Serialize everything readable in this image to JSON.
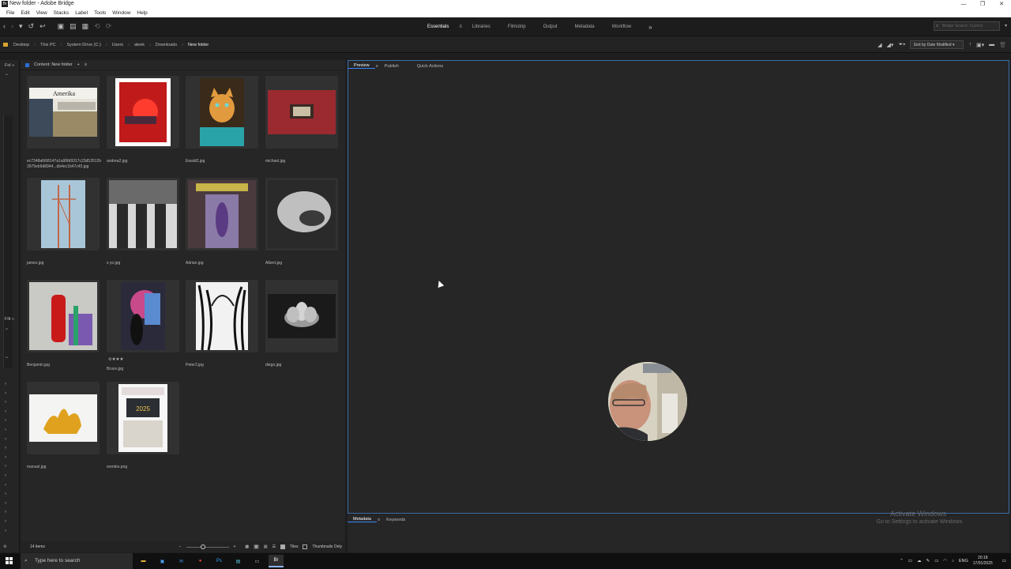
{
  "window": {
    "title": "New folder - Adobe Bridge",
    "app_icon": "Br",
    "minimize": "—",
    "restore": "❐",
    "close": "✕"
  },
  "menu": [
    "File",
    "Edit",
    "View",
    "Stacks",
    "Label",
    "Tools",
    "Window",
    "Help"
  ],
  "workspaces": {
    "items": [
      "Essentials",
      "Libraries",
      "Filmstrip",
      "Output",
      "Metadata",
      "Workflow"
    ],
    "active": "Essentials",
    "more": "»"
  },
  "search": {
    "placeholder": "Bridge Search: Current"
  },
  "breadcrumb": [
    "Desktop",
    "This PC",
    "System Drive (C:)",
    "Users",
    "aleek",
    "Downloads",
    "New folder"
  ],
  "sort": {
    "label": "Sort by Date Modified"
  },
  "left_panels": {
    "folders": "Fol",
    "filter": "Filt"
  },
  "content_panel": {
    "title": "Content: New folder",
    "add": "+"
  },
  "files": [
    {
      "name": "ec7348afb58147a1a90fd9317c23d53512b3975eb9d8944...db4ec1b47c45.jpg",
      "kind": "newspaper"
    },
    {
      "name": "andrea2.jpg",
      "kind": "red-frame"
    },
    {
      "name": "Ewald2.jpg",
      "kind": "kitten"
    },
    {
      "name": "michael.jpg",
      "kind": "red-wall"
    },
    {
      "name": "james.jpg",
      "kind": "pylon"
    },
    {
      "name": "s yo.jpg",
      "kind": "bw-stairs"
    },
    {
      "name": "Adrian.jpg",
      "kind": "doorway"
    },
    {
      "name": "Albert.jpg",
      "kind": "bw-hand"
    },
    {
      "name": "Benjamin.jpg",
      "kind": "extinguisher"
    },
    {
      "name": "Bruce.jpg",
      "kind": "graffiti",
      "rating": "⊘★★★"
    },
    {
      "name": "Peter2.jpg",
      "kind": "bw-trees"
    },
    {
      "name": "diego.jpg",
      "kind": "bw-lotus"
    },
    {
      "name": "manuel.jpg",
      "kind": "coral"
    },
    {
      "name": "sremko.png",
      "kind": "calendar",
      "calendar_text": "2025"
    }
  ],
  "status": {
    "count": "14 items",
    "tiles_label": "Tiles",
    "thumbs_only_label": "Thumbnails Only",
    "zoom_fraction": 0.4
  },
  "preview_tabs": [
    "Preview",
    "Publish",
    "Quick Actions"
  ],
  "bottom_tabs": [
    "Metadata",
    "Keywords"
  ],
  "activation": {
    "title": "Activate Windows",
    "subtitle": "Go to Settings to activate Windows."
  },
  "taskbar": {
    "search_placeholder": "Type here to search",
    "lang": "ENG",
    "time": "20:18",
    "date": "17/01/2025"
  }
}
